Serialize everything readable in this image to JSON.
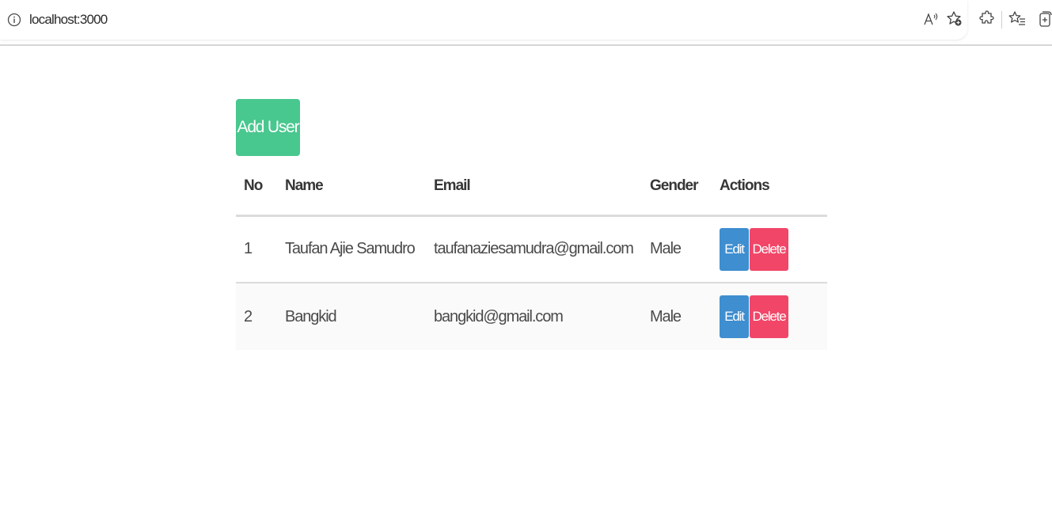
{
  "browser": {
    "url": "localhost:3000",
    "icons": [
      "info-icon",
      "read-aloud-icon",
      "favorite-star-icon",
      "extensions-icon",
      "favorites-icon",
      "collections-icon"
    ]
  },
  "toolbar": {
    "add_user_label": "Add User"
  },
  "table": {
    "headers": {
      "no": "No",
      "name": "Name",
      "email": "Email",
      "gender": "Gender",
      "actions": "Actions"
    },
    "rows": [
      {
        "no": "1",
        "name": "Taufan Ajie Samudro",
        "email": "taufanaziesamudra@gmail.com",
        "gender": "Male",
        "edit": "Edit",
        "delete": "Delete"
      },
      {
        "no": "2",
        "name": "Bangkid",
        "email": "bangkid@gmail.com",
        "gender": "Male",
        "edit": "Edit",
        "delete": "Delete"
      }
    ]
  },
  "colors": {
    "primary": "#48c78e",
    "edit": "#3e8ed0",
    "delete": "#f14668"
  }
}
